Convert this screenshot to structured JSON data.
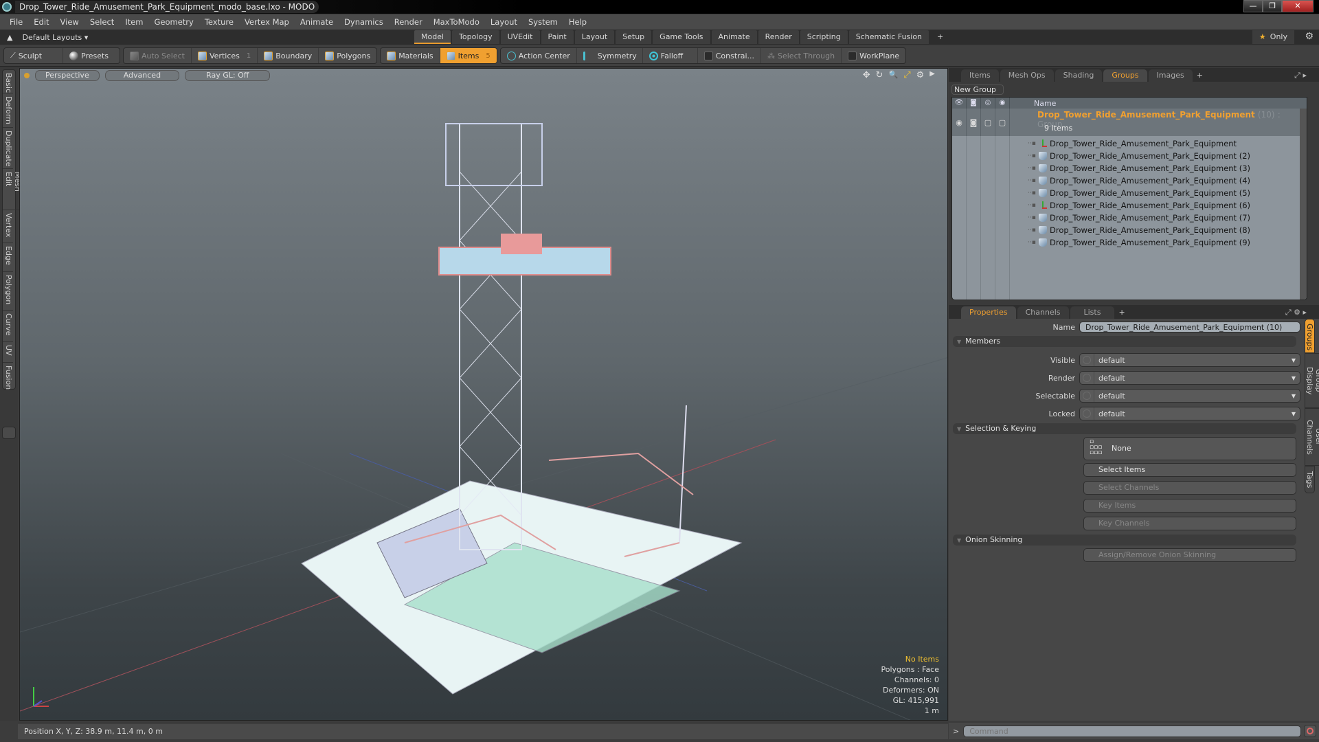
{
  "window": {
    "title": "Drop_Tower_Ride_Amusement_Park_Equipment_modo_base.lxo - MODO",
    "controls": {
      "minimize": "—",
      "restore": "❐",
      "close": "✕"
    }
  },
  "menu": [
    "File",
    "Edit",
    "View",
    "Select",
    "Item",
    "Geometry",
    "Texture",
    "Vertex Map",
    "Animate",
    "Dynamics",
    "Render",
    "MaxToModo",
    "Layout",
    "System",
    "Help"
  ],
  "layouts": {
    "label": "Default Layouts ▾",
    "icon": "▲"
  },
  "mode_tabs": [
    {
      "label": "Model",
      "active": true
    },
    {
      "label": "Topology"
    },
    {
      "label": "UVEdit"
    },
    {
      "label": "Paint"
    },
    {
      "label": "Layout"
    },
    {
      "label": "Setup"
    },
    {
      "label": "Game Tools"
    },
    {
      "label": "Animate"
    },
    {
      "label": "Render"
    },
    {
      "label": "Scripting"
    },
    {
      "label": "Schematic Fusion"
    }
  ],
  "mode_add": "+",
  "only_button": {
    "star": "★",
    "label": "Only"
  },
  "gear": "⚙",
  "toolbar": {
    "sculpt": "Sculpt",
    "presets": "Presets",
    "auto_select": "Auto Select",
    "vertices": "Vertices",
    "vertices_count": "1",
    "boundary": "Boundary",
    "polygons": "Polygons",
    "materials": "Materials",
    "items": "Items",
    "items_count": "5",
    "action_center": "Action Center",
    "symmetry": "Symmetry",
    "falloff": "Falloff",
    "constraints": "Constrai...",
    "select_through": "Select Through",
    "workplane": "WorkPlane"
  },
  "left_tabs": [
    "Basic",
    "Deform",
    "Duplicate",
    "Mesh Edit",
    "Vertex",
    "Edge",
    "Polygon",
    "Curve",
    "UV",
    "Fusion"
  ],
  "viewport": {
    "view": "Perspective",
    "shading": "Advanced",
    "raygl": "Ray GL: Off",
    "icons": [
      "✥",
      "↻",
      "🔍",
      "⤢",
      "⚙",
      "▶"
    ],
    "stats": {
      "selection": "No Items",
      "polygons": "Polygons : Face",
      "channels": "Channels: 0",
      "deformers": "Deformers: ON",
      "gl": "GL: 415,991",
      "scale": "1 m"
    }
  },
  "scene_panel": {
    "tabs": [
      {
        "label": "Items"
      },
      {
        "label": "Mesh Ops"
      },
      {
        "label": "Shading"
      },
      {
        "label": "Groups",
        "active": true
      },
      {
        "label": "Images"
      }
    ],
    "add": "+",
    "new_group": "New Group",
    "header_name": "Name",
    "group": {
      "name": "Drop_Tower_Ride_Amusement_Park_Equipment",
      "count": "(10)",
      "type": ": Group",
      "sub": "9 Items"
    },
    "items": [
      {
        "name": "Drop_Tower_Ride_Amusement_Park_Equipment",
        "icon": "locator"
      },
      {
        "name": "Drop_Tower_Ride_Amusement_Park_Equipment (2)",
        "icon": "mesh"
      },
      {
        "name": "Drop_Tower_Ride_Amusement_Park_Equipment (3)",
        "icon": "mesh"
      },
      {
        "name": "Drop_Tower_Ride_Amusement_Park_Equipment (4)",
        "icon": "mesh"
      },
      {
        "name": "Drop_Tower_Ride_Amusement_Park_Equipment (5)",
        "icon": "mesh"
      },
      {
        "name": "Drop_Tower_Ride_Amusement_Park_Equipment (6)",
        "icon": "locator"
      },
      {
        "name": "Drop_Tower_Ride_Amusement_Park_Equipment (7)",
        "icon": "mesh"
      },
      {
        "name": "Drop_Tower_Ride_Amusement_Park_Equipment (8)",
        "icon": "mesh"
      },
      {
        "name": "Drop_Tower_Ride_Amusement_Park_Equipment (9)",
        "icon": "mesh"
      }
    ]
  },
  "properties": {
    "tabs": [
      {
        "label": "Properties",
        "active": true
      },
      {
        "label": "Channels"
      },
      {
        "label": "Lists"
      }
    ],
    "add": "+",
    "name_label": "Name",
    "name_value": "Drop_Tower_Ride_Amusement_Park_Equipment (10)",
    "members_section": "Members",
    "fields": [
      {
        "label": "Visible",
        "value": "default"
      },
      {
        "label": "Render",
        "value": "default"
      },
      {
        "label": "Selectable",
        "value": "default"
      },
      {
        "label": "Locked",
        "value": "default"
      }
    ],
    "selection_section": "Selection & Keying",
    "none_button": "None",
    "select_items": "Select Items",
    "select_channels": "Select Channels",
    "key_items": "Key Items",
    "key_channels": "Key Channels",
    "onion_section": "Onion Skinning",
    "onion_button": "Assign/Remove Onion Skinning",
    "side_tabs": [
      {
        "label": "Groups",
        "active": true
      },
      {
        "label": "Group Display"
      },
      {
        "label": "User Channels"
      },
      {
        "label": "Tags"
      }
    ]
  },
  "status": {
    "position": "Position X, Y, Z:   38.9 m, 11.4 m, 0 m"
  },
  "command": {
    "prompt": ">",
    "placeholder": "Command"
  }
}
